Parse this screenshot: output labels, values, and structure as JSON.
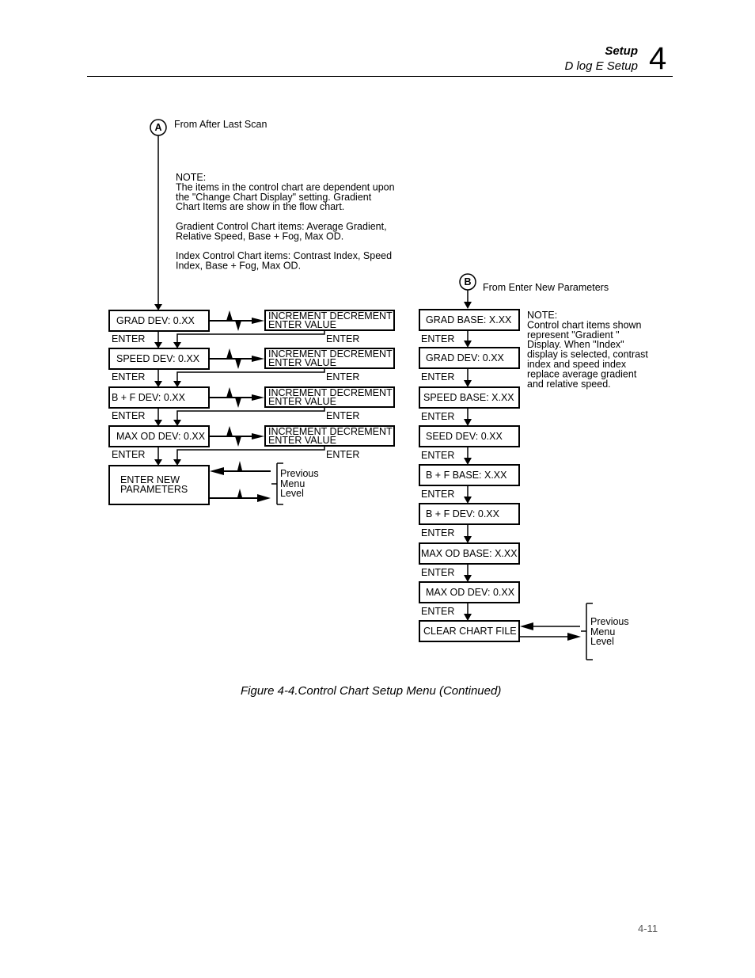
{
  "header": {
    "section": "Setup",
    "subsection": "D log E Setup",
    "chapter": "4"
  },
  "flow_a": {
    "connector_label": "A",
    "connector_caption": "From After Last Scan",
    "note_lines": [
      "NOTE:",
      "The items in the control chart are dependent upon",
      "the \"Change Chart Display\" setting.  Gradient",
      "Chart Items are show in the flow chart.",
      "",
      "Gradient Control Chart items: Average Gradient,",
      "Relative Speed, Base + Fog, Max OD.",
      "",
      "Index Control Chart items: Contrast Index, Speed",
      "Index, Base + Fog, Max OD."
    ],
    "steps": [
      {
        "label": "GRAD DEV: 0.XX",
        "edit_line1": "INCREMENT DECREMENT",
        "edit_line2": "ENTER VALUE"
      },
      {
        "label": "SPEED DEV: 0.XX",
        "edit_line1": "INCREMENT DECREMENT",
        "edit_line2": "ENTER VALUE"
      },
      {
        "label": "B + F DEV: 0.XX",
        "edit_line1": "INCREMENT DECREMENT",
        "edit_line2": "ENTER VALUE"
      },
      {
        "label": "MAX OD DEV: 0.XX",
        "edit_line1": "INCREMENT DECREMENT",
        "edit_line2": "ENTER VALUE"
      }
    ],
    "enter_label": "ENTER",
    "final_line1": "ENTER NEW",
    "final_line2": "PARAMETERS",
    "prev_menu": [
      "Previous",
      "Menu",
      "Level"
    ]
  },
  "flow_b": {
    "connector_label": "B",
    "connector_caption": "From Enter New Parameters",
    "note_lines": [
      "NOTE:",
      "Control chart items shown",
      "represent \"Gradient \"",
      "Display.  When \"Index\"",
      "display is selected, contrast",
      "index and speed index",
      "replace average gradient",
      "and relative speed."
    ],
    "steps": [
      "GRAD BASE: X.XX",
      "GRAD DEV: 0.XX",
      "SPEED BASE: X.XX",
      "SEED DEV: 0.XX",
      "B + F BASE: X.XX",
      "B + F DEV: 0.XX",
      "MAX OD BASE: X.XX",
      "MAX OD DEV: 0.XX",
      "CLEAR CHART FILE"
    ],
    "enter_label": "ENTER",
    "prev_menu": [
      "Previous",
      "Menu",
      "Level"
    ]
  },
  "caption": "Figure 4-4.Control Chart Setup Menu (Continued)",
  "page_number": "4-11"
}
